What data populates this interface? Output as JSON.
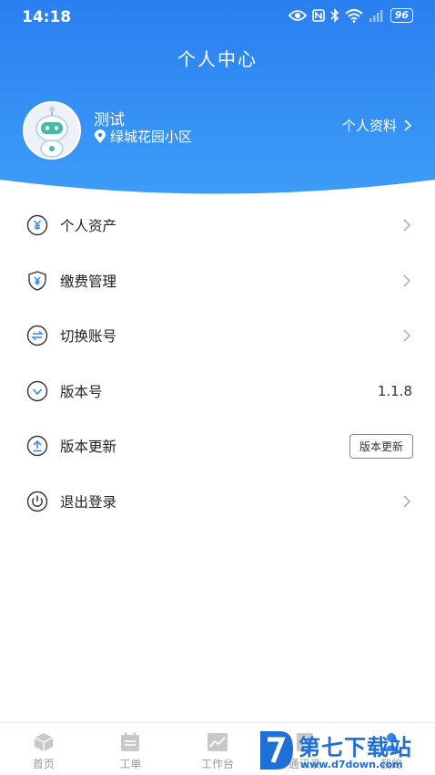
{
  "status_bar": {
    "time": "14:18",
    "battery": "96"
  },
  "header": {
    "title": "个人中心"
  },
  "user": {
    "name": "测试",
    "location": "绿城花园小区",
    "profile_link": "个人资料"
  },
  "menu": [
    {
      "label": "个人资产",
      "icon": "yuan-circle-icon"
    },
    {
      "label": "缴费管理",
      "icon": "shield-yuan-icon"
    },
    {
      "label": "切换账号",
      "icon": "switch-arrows-icon"
    },
    {
      "label": "版本号",
      "icon": "chevron-down-circle-icon",
      "value": "1.1.8"
    },
    {
      "label": "版本更新",
      "icon": "upload-circle-icon",
      "button": "版本更新"
    },
    {
      "label": "退出登录",
      "icon": "power-icon"
    }
  ],
  "bottom_nav": [
    {
      "label": "首页",
      "icon": "cube-icon"
    },
    {
      "label": "工单",
      "icon": "calendar-list-icon"
    },
    {
      "label": "工作台",
      "icon": "chart-line-icon"
    },
    {
      "label": "通讯录",
      "icon": "contacts-icon"
    },
    {
      "label": "我的",
      "icon": "person-icon"
    }
  ],
  "watermark": {
    "text": "第七下载站",
    "url": "www.d7down.com"
  },
  "colors": {
    "header_top": "#2a7ff0",
    "header_bottom": "#3b97f5",
    "icon_stroke": "#333333",
    "nav_inactive": "#999999"
  }
}
